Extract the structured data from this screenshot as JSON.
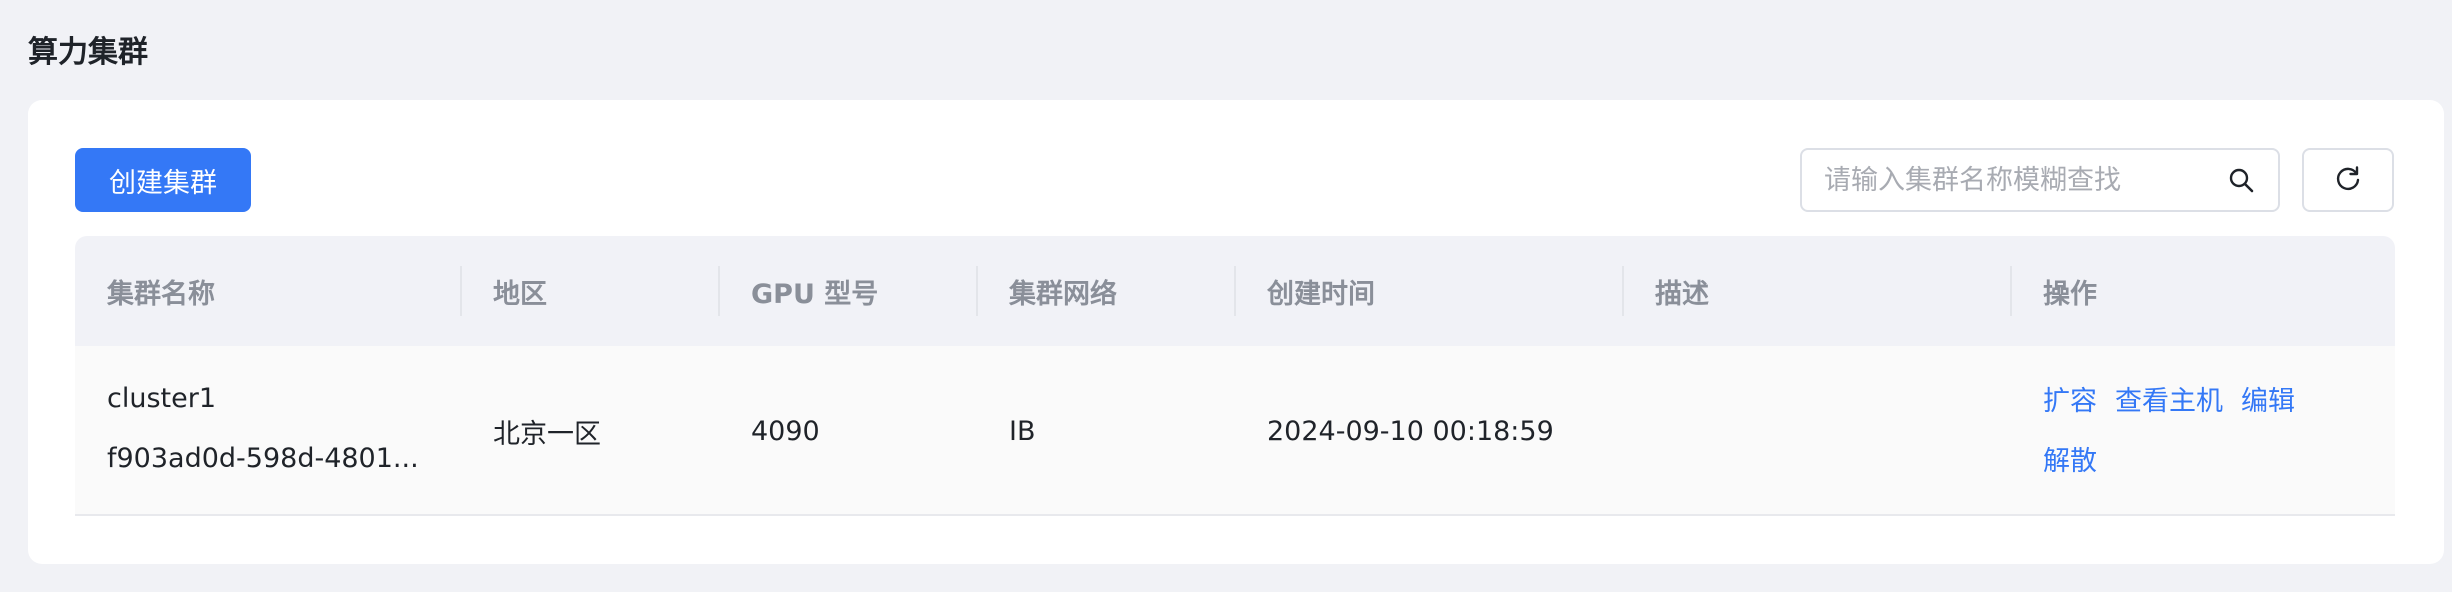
{
  "page": {
    "title": "算力集群"
  },
  "toolbar": {
    "create_label": "创建集群",
    "search_placeholder": "请输入集群名称模糊查找",
    "search_value": ""
  },
  "table": {
    "columns": [
      "集群名称",
      "地区",
      "GPU 型号",
      "集群网络",
      "创建时间",
      "描述",
      "操作"
    ],
    "rows": [
      {
        "name": "cluster1",
        "id": "f903ad0d-598d-4801...",
        "region": "北京一区",
        "gpu": "4090",
        "network": "IB",
        "created": "2024-09-10 00:18:59",
        "description": "",
        "actions": [
          "扩容",
          "查看主机",
          "编辑",
          "解散"
        ]
      }
    ]
  },
  "colors": {
    "primary": "#3478f6",
    "background": "#f1f2f6",
    "header_bg": "#f1f2f7"
  },
  "icons": {
    "search": "search-icon",
    "refresh": "refresh-icon"
  }
}
